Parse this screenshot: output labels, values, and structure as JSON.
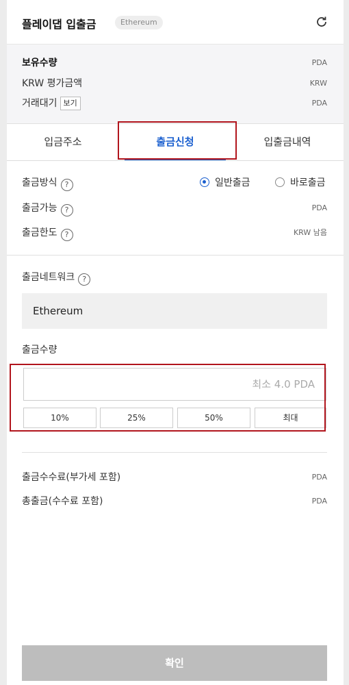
{
  "header": {
    "title": "플레이댑 입출금",
    "network_badge": "Ethereum"
  },
  "holdings": {
    "rows": [
      {
        "label": "보유수량",
        "value": "PDA"
      },
      {
        "label": "KRW 평가금액",
        "value": "KRW"
      },
      {
        "label": "거래대기",
        "value": "PDA",
        "button": "보기"
      }
    ]
  },
  "tabs": [
    {
      "label": "입금주소",
      "active": false
    },
    {
      "label": "출금신청",
      "active": true
    },
    {
      "label": "입출금내역",
      "active": false
    }
  ],
  "withdraw": {
    "method_label": "출금방식",
    "method_options": [
      {
        "label": "일반출금",
        "selected": true
      },
      {
        "label": "바로출금",
        "selected": false
      }
    ],
    "available_label": "출금가능",
    "available_value": "PDA",
    "limit_label": "출금한도",
    "limit_value": "KRW 남음",
    "help_glyph": "?",
    "network_label": "출금네트워크",
    "network_value": "Ethereum",
    "amount_label": "출금수량",
    "amount_placeholder": "최소 4.0 PDA",
    "amount_value": "",
    "percent_buttons": [
      "10%",
      "25%",
      "50%",
      "최대"
    ],
    "fee_label": "출금수수료(부가세 포함)",
    "fee_value": "PDA",
    "total_label": "총출금(수수료 포함)",
    "total_value": "PDA",
    "confirm_label": "확인"
  },
  "colors": {
    "accent": "#1a5fcf",
    "highlight_box": "#b1141c",
    "confirm_disabled": "#bdbdbd"
  },
  "icons": {
    "refresh": "refresh-icon",
    "help": "help-icon"
  }
}
